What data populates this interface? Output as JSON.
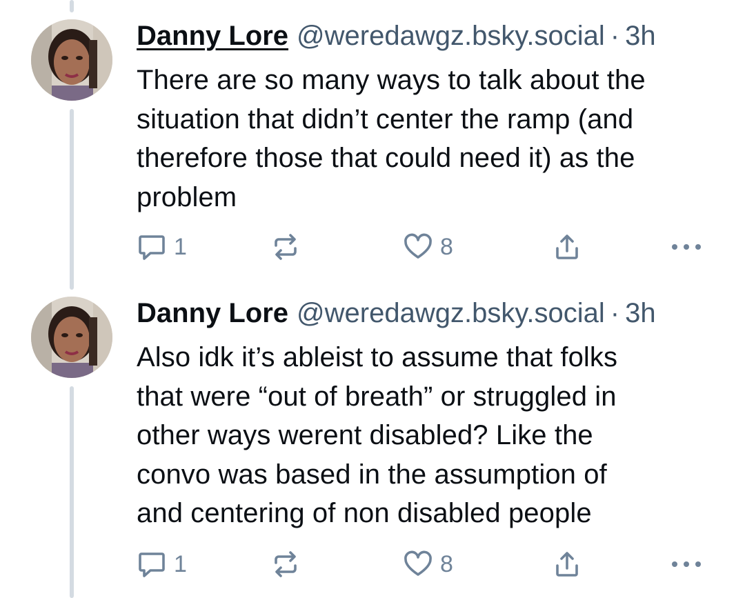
{
  "thread": {
    "posts": [
      {
        "author_name": "Danny Lore",
        "handle": "@weredawgz.bsky.social",
        "separator": "·",
        "time": "3h",
        "text_lines": [
          "There are so many ways to talk about the",
          "situation that didn’t center the ramp (and",
          "therefore those that could need it) as the",
          "problem"
        ],
        "reply_count": "1",
        "like_count": "8"
      },
      {
        "author_name": "Danny Lore",
        "handle": "@weredawgz.bsky.social",
        "separator": "·",
        "time": "3h",
        "text_lines": [
          "Also idk it’s ableist to assume that folks",
          "that were “out of breath” or struggled in",
          "other ways werent disabled? Like the",
          "convo was based in the assumption of",
          "and centering of non disabled people"
        ],
        "reply_count": "1",
        "like_count": "8"
      }
    ]
  },
  "icons": {
    "reply": "reply-icon",
    "repost": "repost-icon",
    "like": "heart-icon",
    "share": "share-icon",
    "more": "more-dots-icon"
  },
  "colors": {
    "text": "#0b0f14",
    "muted": "#42576c",
    "icon": "#6f8399",
    "thread_line": "#d4dbe2"
  }
}
